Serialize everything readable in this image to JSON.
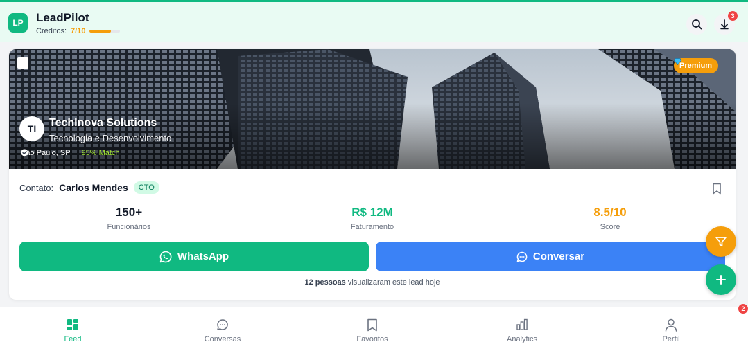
{
  "app": {
    "logo_initials": "LP",
    "name": "LeadPilot",
    "credits_label": "Créditos:",
    "credits_value": "7/10",
    "credits_fraction": 0.7,
    "downloads_badge": "3"
  },
  "lead": {
    "premium_label": "Premium",
    "initials": "TI",
    "company": "TechInova Solutions",
    "sector": "Tecnologia e Desenvolvimento",
    "location": "São Paulo, SP",
    "match": "95% Match",
    "contact_label": "Contato:",
    "contact_name": "Carlos Mendes",
    "contact_role": "CTO",
    "stats": [
      {
        "value": "150+",
        "label": "Funcionários",
        "color": "#111827"
      },
      {
        "value": "R$ 12M",
        "label": "Faturamento",
        "color": "#10b981"
      },
      {
        "value": "8.5/10",
        "label": "Score",
        "color": "#f59e0b"
      }
    ],
    "whatsapp_label": "WhatsApp",
    "chat_label": "Conversar",
    "views_count": "12 pessoas",
    "views_text": " visualizaram este lead hoje"
  },
  "nav": {
    "items": [
      {
        "label": "Feed",
        "icon": "grid-icon"
      },
      {
        "label": "Conversas",
        "icon": "chat-icon"
      },
      {
        "label": "Favoritos",
        "icon": "bookmark-icon"
      },
      {
        "label": "Analytics",
        "icon": "chart-icon"
      },
      {
        "label": "Perfil",
        "icon": "user-icon"
      }
    ],
    "badge": "2"
  },
  "colors": {
    "brand": "#10b981",
    "accent": "#f59e0b",
    "chat": "#3b82f6"
  }
}
